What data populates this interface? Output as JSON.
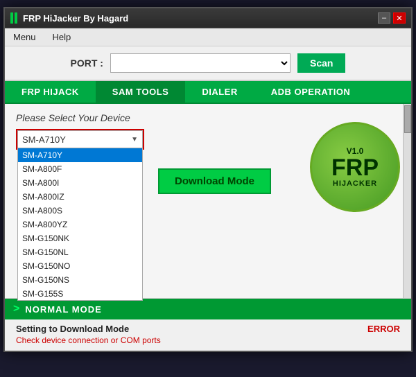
{
  "window": {
    "title": "FRP HiJacker By Hagard",
    "icon_bars": [
      "bar1",
      "bar2"
    ],
    "controls": {
      "minimize": "–",
      "close": "✕"
    }
  },
  "menu": {
    "items": [
      "Menu",
      "Help"
    ]
  },
  "port_row": {
    "label": "PORT :",
    "placeholder": "",
    "scan_button": "Scan"
  },
  "tabs": [
    {
      "label": "FRP HIJACK",
      "active": false
    },
    {
      "label": "SAM TOOLS",
      "active": true
    },
    {
      "label": "DIALER",
      "active": false
    },
    {
      "label": "ADB OPERATION",
      "active": false
    }
  ],
  "main": {
    "please_select_label": "Please Select Your Device",
    "selected_device": "SM-A710Y",
    "devices": [
      "SM-A710Y",
      "SM-A800F",
      "SM-A800I",
      "SM-A800IZ",
      "SM-A800S",
      "SM-A800YZ",
      "SM-G150NK",
      "SM-G150NL",
      "SM-G150NO",
      "SM-G150NS",
      "SM-G155S"
    ],
    "download_mode_button": "Download Mode",
    "frp_logo": {
      "version": "V1.0",
      "title": "FRP",
      "subtitle": "HIJACKER"
    }
  },
  "status": {
    "mode_label": "NORMAL MODE",
    "arrow": ">",
    "setting_label": "Setting to Download Mode",
    "error_label": "ERROR",
    "detail_label": "Check device connection or COM ports"
  }
}
